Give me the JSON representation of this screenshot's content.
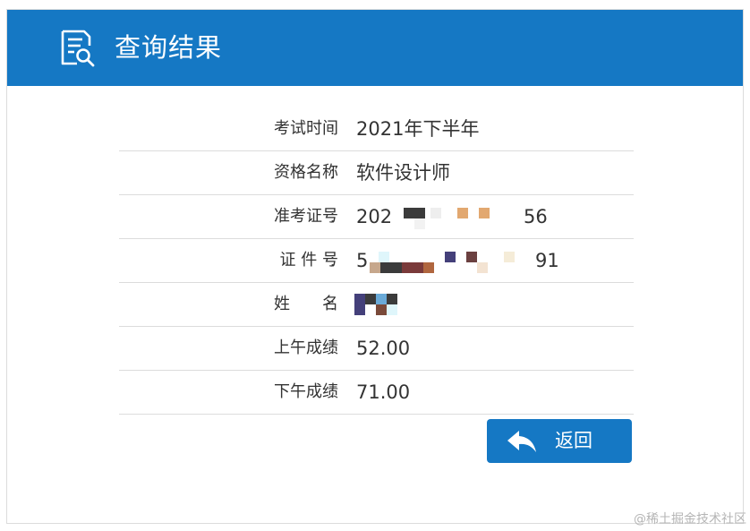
{
  "header": {
    "title": "查询结果",
    "icon": "document-search-icon",
    "color": "#1578c4"
  },
  "rows": [
    {
      "label": "考试时间",
      "value": "2021年下半年"
    },
    {
      "label": "资格名称",
      "value": "软件设计师"
    },
    {
      "label": "准考证号",
      "value": "202",
      "value_tail": "56",
      "masked": true
    },
    {
      "label": "证 件 号",
      "value": "5",
      "value_tail": "91",
      "masked": true
    },
    {
      "label": "姓　　名",
      "value": "",
      "masked": true
    },
    {
      "label": "上午成绩",
      "value": "52.00"
    },
    {
      "label": "下午成绩",
      "value": "71.00"
    }
  ],
  "colon": ":",
  "back_button": {
    "label": "返回",
    "icon": "reply-arrow-icon"
  },
  "watermark": "@稀土掘金技术社区"
}
